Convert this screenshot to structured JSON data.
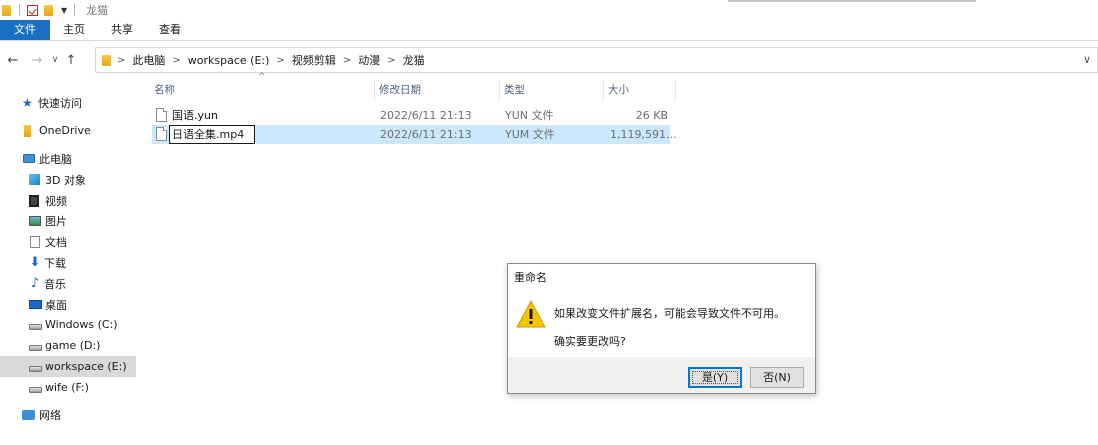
{
  "window": {
    "title": "龙猫"
  },
  "ribbon": {
    "tabs": [
      {
        "label": "文件",
        "active": true
      },
      {
        "label": "主页"
      },
      {
        "label": "共享"
      },
      {
        "label": "查看"
      }
    ]
  },
  "address": {
    "crumbs": [
      "此电脑",
      "workspace (E:)",
      "视频剪辑",
      "动漫",
      "龙猫"
    ]
  },
  "sidebar": {
    "items": [
      {
        "label": "快速访问",
        "icon": "star-icon"
      },
      {
        "label": "OneDrive",
        "icon": "onedrive-icon"
      },
      {
        "label": "此电脑",
        "icon": "pc-icon"
      },
      {
        "label": "3D 对象",
        "icon": "3d-objects-icon"
      },
      {
        "label": "视频",
        "icon": "video-icon"
      },
      {
        "label": "图片",
        "icon": "pictures-icon"
      },
      {
        "label": "文档",
        "icon": "documents-icon"
      },
      {
        "label": "下载",
        "icon": "download-icon"
      },
      {
        "label": "音乐",
        "icon": "music-icon"
      },
      {
        "label": "桌面",
        "icon": "desktop-icon"
      },
      {
        "label": "Windows (C:)",
        "icon": "drive-icon"
      },
      {
        "label": "game (D:)",
        "icon": "drive-icon"
      },
      {
        "label": "workspace (E:)",
        "icon": "drive-icon",
        "selected": true
      },
      {
        "label": "wife (F:)",
        "icon": "drive-icon"
      },
      {
        "label": "网络",
        "icon": "network-icon"
      }
    ]
  },
  "columns": {
    "name": "名称",
    "date": "修改日期",
    "type": "类型",
    "size": "大小"
  },
  "files": [
    {
      "name": "国语.yun",
      "date": "2022/6/11 21:13",
      "type": "YUN 文件",
      "size": "26 KB"
    },
    {
      "name": "日语全集.mp4",
      "date": "2022/6/11 21:13",
      "type": "YUM 文件",
      "size": "1,119,591...",
      "renaming": true
    }
  ],
  "dialog": {
    "title": "重命名",
    "message": "如果改变文件扩展名，可能会导致文件不可用。",
    "question": "确实要更改吗?",
    "yes_label": "是(Y)",
    "no_label": "否(N)"
  },
  "colors": {
    "accent": "#1a6fc4",
    "selection": "#cce8ff",
    "warning": "#f5c400"
  }
}
